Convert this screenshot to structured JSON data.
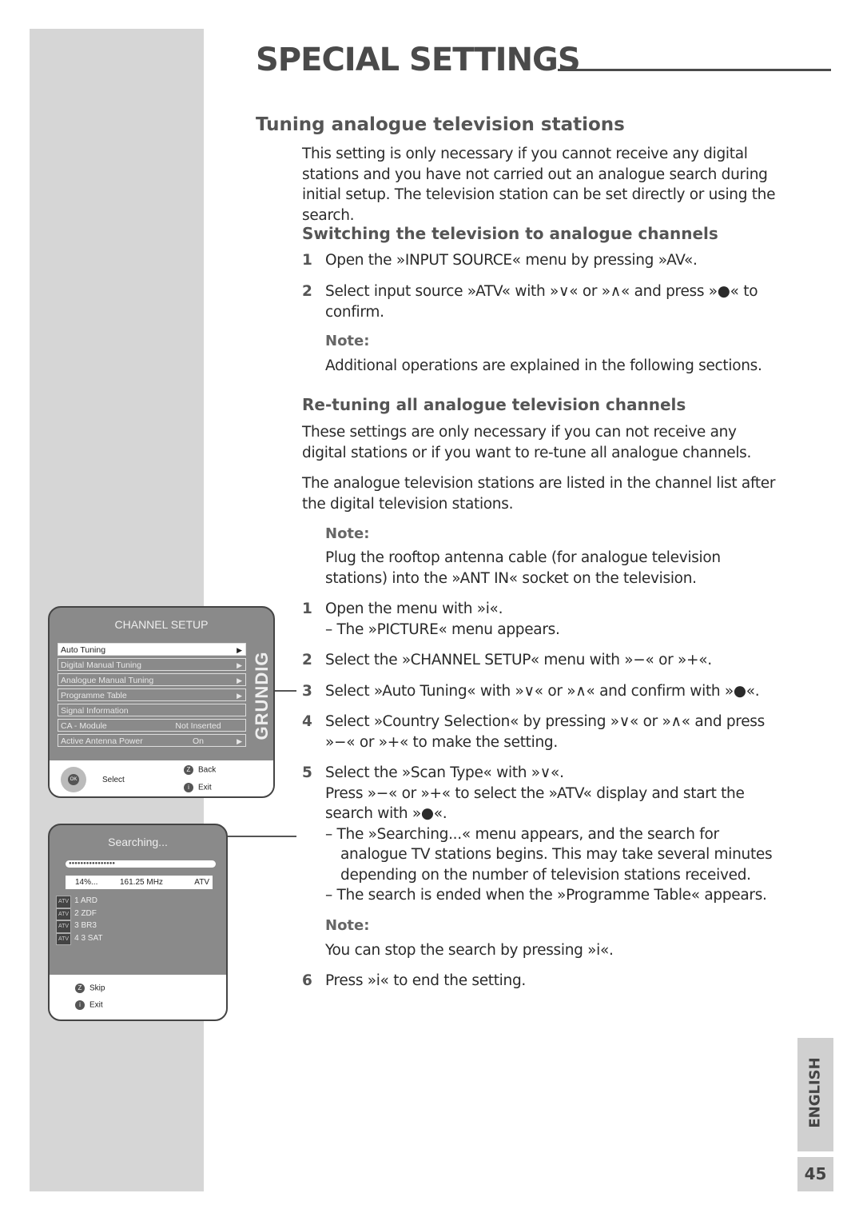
{
  "header": {
    "title": "SPECIAL SETTINGS"
  },
  "section": {
    "title": "Tuning analogue television stations",
    "intro": "This setting is only necessary if you cannot receive any digital stations and you have not carried out an analogue search during initial setup. The television station can be set directly or using the search."
  },
  "switching": {
    "title": "Switching the television to analogue channels",
    "steps": [
      {
        "n": "1",
        "text": "Open the »INPUT SOURCE« menu by pressing »AV«."
      },
      {
        "n": "2",
        "text": "Select input source »ATV« with »∨« or »∧« and press »●« to confirm."
      }
    ],
    "note_label": "Note:",
    "note": "Additional operations are explained in the following sections."
  },
  "retuning": {
    "title": "Re-tuning all analogue television channels",
    "p1": "These settings are only necessary if you can not receive any digital stations or if you want to re-tune all analogue channels.",
    "p2": "The analogue television stations are listed in the channel list after the digital television stations.",
    "note_label": "Note:",
    "note": "Plug the rooftop antenna cable (for analogue television stations) into the »ANT IN« socket on the television.",
    "steps": [
      {
        "n": "1",
        "text": "Open the menu with »i«.",
        "sub": "– The »PICTURE« menu appears."
      },
      {
        "n": "2",
        "text": "Select the »CHANNEL SETUP« menu with »−« or »+«."
      },
      {
        "n": "3",
        "text": "Select »Auto Tuning« with »∨« or »∧« and confirm with »●«."
      },
      {
        "n": "4",
        "text": "Select »Country Selection« by pressing »∨« or »∧« and press »−« or »+« to make the setting."
      },
      {
        "n": "5",
        "text": "Select the »Scan Type« with »∨«.",
        "text2": "Press »−« or »+« to select the »ATV« display and start the search with »●«.",
        "sub1": "– The »Searching...« menu appears, and the search for analogue TV stations begins. This may take several minutes depending on the number of television stations received.",
        "sub2": "– The search is ended when the »Programme Table« appears."
      }
    ],
    "note2_label": "Note:",
    "note2": "You can stop the search by pressing »i«.",
    "step6": {
      "n": "6",
      "text": "Press »i« to end the setting."
    }
  },
  "channel_menu": {
    "title": "CHANNEL SETUP",
    "brand": "GRUNDIG",
    "items": [
      {
        "label": "Auto Tuning",
        "value": "",
        "arrow": "▶"
      },
      {
        "label": "Digital Manual Tuning",
        "value": "",
        "arrow": "▶"
      },
      {
        "label": "Analogue Manual Tuning",
        "value": "",
        "arrow": "▶"
      },
      {
        "label": "Programme Table",
        "value": "",
        "arrow": "▶"
      },
      {
        "label": "Signal Information",
        "value": "",
        "arrow": ""
      },
      {
        "label": "CA - Module",
        "value": "Not Inserted",
        "arrow": ""
      },
      {
        "label": "Active Antenna Power",
        "value": "On",
        "arrow": "▶"
      }
    ],
    "ok": "OK",
    "select": "Select",
    "back_key": "Z",
    "back": "Back",
    "exit_key": "i",
    "exit": "Exit"
  },
  "search_menu": {
    "title": "Searching...",
    "progress_dots": "●●●●●●●●●●●●●●●●",
    "progress_percent": 14,
    "percent": "14%...",
    "freq": "161.25 MHz",
    "type": "ATV",
    "stations": [
      {
        "tag": "ATV",
        "name": "1 ARD"
      },
      {
        "tag": "ATV",
        "name": "2 ZDF"
      },
      {
        "tag": "ATV",
        "name": "3 BR3"
      },
      {
        "tag": "ATV",
        "name": "4 3 SAT"
      }
    ],
    "skip_key": "Z",
    "skip": "Skip",
    "exit_key": "i",
    "exit": "Exit"
  },
  "footer": {
    "language": "ENGLISH",
    "page": "45"
  }
}
